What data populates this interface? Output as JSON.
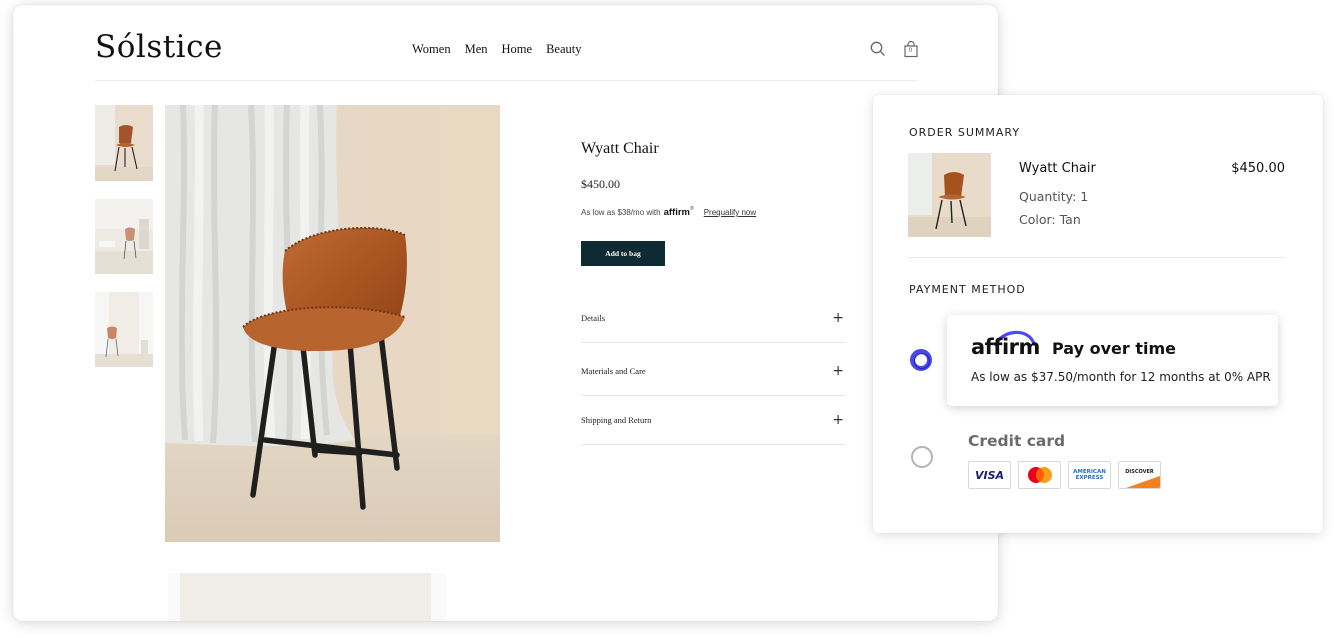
{
  "shop": {
    "logo": "Sólstice",
    "nav": [
      "Women",
      "Men",
      "Home",
      "Beauty"
    ],
    "icons": {
      "search": "search-icon",
      "bag": "shopping-bag-icon"
    },
    "bag_count": "0"
  },
  "product": {
    "title": "Wyatt Chair",
    "price": "$450.00",
    "as_low_prefix": "As low as $38/mo with",
    "affirm_small": "affirm",
    "prequalify": "Prequalify now",
    "add_to_bag": "Add to bag",
    "accordions": [
      "Details",
      "Materials and Care",
      "Shipping and Return"
    ],
    "accordion_icon": "plus-icon"
  },
  "checkout": {
    "order_summary_title": "ORDER SUMMARY",
    "item": {
      "name": "Wyatt Chair",
      "price": "$450.00",
      "quantity": "Quantity: 1",
      "color": "Color: Tan"
    },
    "payment_method_title": "PAYMENT METHOD",
    "affirm": {
      "logo": "affirm",
      "title": "Pay over time",
      "description": "As low as $37.50/month for 12 months at 0% APR",
      "selected": true
    },
    "credit_card": {
      "label": "Credit card",
      "brands": [
        "VISA",
        "AMERICAN EXPRESS",
        "DISCOVER"
      ],
      "selected": false
    }
  },
  "colors": {
    "add_to_bag_bg": "#0e2a33",
    "affirm_blue": "#4a4af4",
    "radio_selected": "#1d1dc9",
    "discover_orange": "#f48120"
  }
}
